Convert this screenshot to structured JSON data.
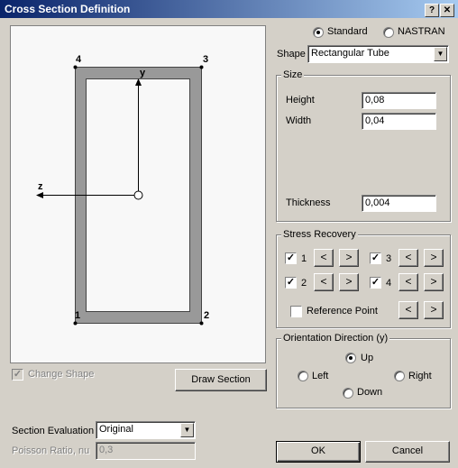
{
  "window": {
    "title": "Cross Section Definition",
    "help_label": "?",
    "close_label": "✕"
  },
  "shape_type": {
    "standard_label": "Standard",
    "nastran_label": "NASTRAN",
    "selected": "Standard"
  },
  "shape": {
    "label": "Shape",
    "value": "Rectangular Tube"
  },
  "size": {
    "legend": "Size",
    "height_label": "Height",
    "height_value": "0,08",
    "width_label": "Width",
    "width_value": "0,04",
    "thickness_label": "Thickness",
    "thickness_value": "0,004"
  },
  "stress_recovery": {
    "legend": "Stress Recovery",
    "points": [
      {
        "label": "1",
        "checked": true
      },
      {
        "label": "2",
        "checked": true
      },
      {
        "label": "3",
        "checked": true
      },
      {
        "label": "4",
        "checked": true
      }
    ],
    "reference_point_label": "Reference Point",
    "reference_point_checked": false,
    "left_glyph": "<",
    "right_glyph": ">"
  },
  "orientation": {
    "legend": "Orientation Direction (y)",
    "up_label": "Up",
    "left_label": "Left",
    "right_label": "Right",
    "down_label": "Down",
    "selected": "Up"
  },
  "preview": {
    "corner_labels": [
      "1",
      "2",
      "3",
      "4"
    ],
    "axis_y_label": "y",
    "axis_z_label": "z"
  },
  "change_shape_label": "Change Shape",
  "draw_section_label": "Draw Section",
  "section_evaluation": {
    "label": "Section Evaluation",
    "value": "Original"
  },
  "poisson": {
    "label": "Poisson Ratio, nu",
    "value": "0,3"
  },
  "ok_label": "OK",
  "cancel_label": "Cancel",
  "colors": {
    "title_bar": "#0a246a",
    "dialog_bg": "#d4d0c8",
    "section_fill": "#999999"
  }
}
